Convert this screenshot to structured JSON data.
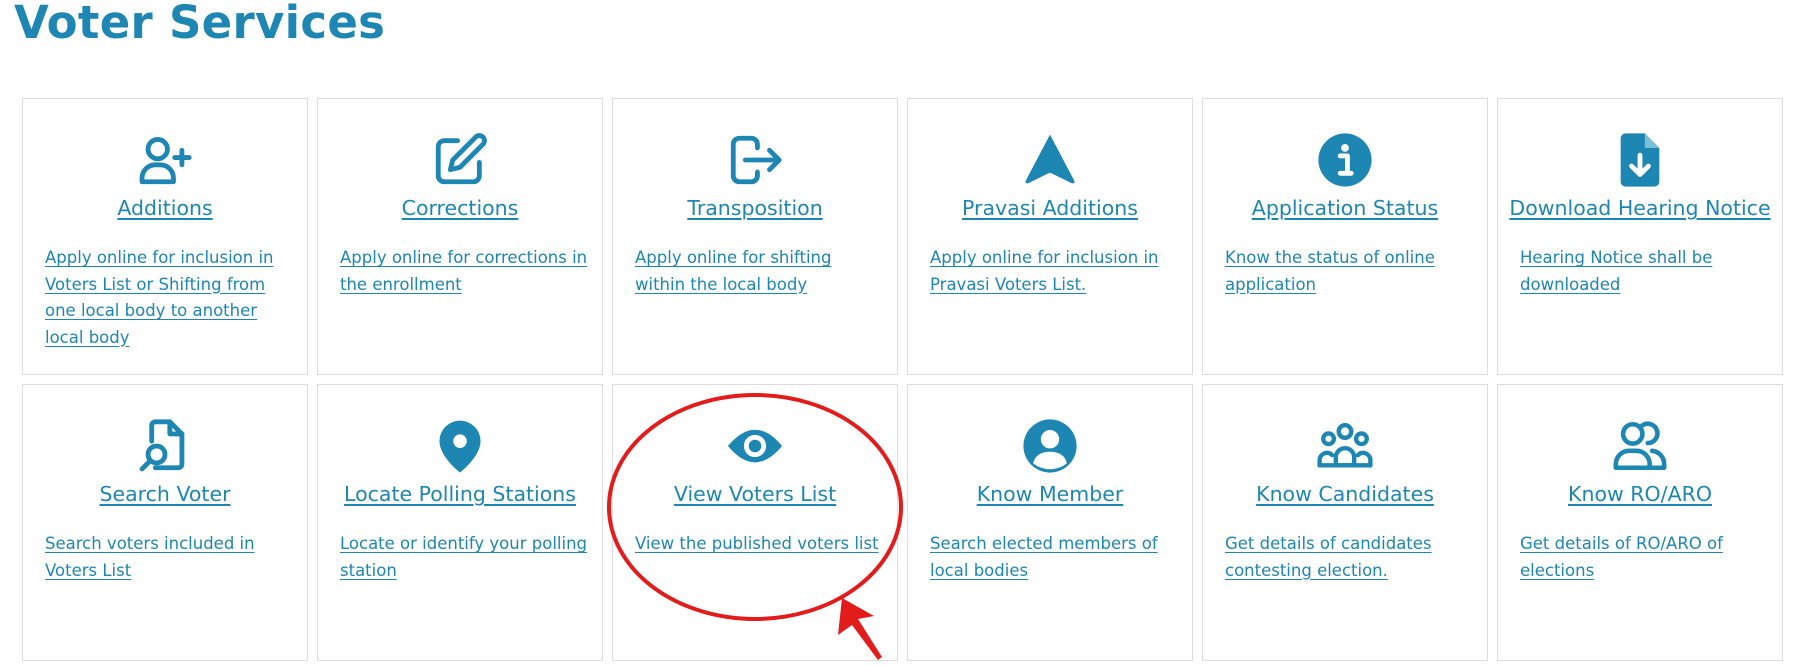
{
  "page_title": "Voter Services",
  "colors": {
    "accent": "#1d86b2",
    "card_border": "#dcdcdc",
    "annotation": "#e31b1b"
  },
  "cards": [
    {
      "title": "Additions",
      "icon": "add-user-icon",
      "description": "Apply online for inclusion in Voters List or Shifting from one local body to another local body"
    },
    {
      "title": "Corrections",
      "icon": "edit-icon",
      "description": "Apply online for corrections in the enrollment"
    },
    {
      "title": "Transposition",
      "icon": "transfer-icon",
      "description": "Apply online for shifting within the local body"
    },
    {
      "title": "Pravasi Additions",
      "icon": "navigation-arrow-icon",
      "description": "Apply online for inclusion in Pravasi Voters List."
    },
    {
      "title": "Application Status",
      "icon": "info-icon",
      "description": "Know the status of online application"
    },
    {
      "title": "Download Hearing Notice",
      "icon": "file-download-icon",
      "description": "Hearing Notice shall be downloaded"
    },
    {
      "title": "Search Voter",
      "icon": "file-search-icon",
      "description": "Search voters included in Voters List"
    },
    {
      "title": "Locate Polling Stations",
      "icon": "map-pin-icon",
      "description": "Locate or identify your polling station"
    },
    {
      "title": "View Voters List",
      "icon": "eye-icon",
      "description": "View the published voters list"
    },
    {
      "title": "Know Member",
      "icon": "user-circle-icon",
      "description": "Search elected members of local bodies"
    },
    {
      "title": "Know Candidates",
      "icon": "group-icon",
      "description": "Get details of candidates contesting election."
    },
    {
      "title": "Know RO/ARO",
      "icon": "users-icon",
      "description": "Get details of RO/ARO of elections"
    }
  ]
}
